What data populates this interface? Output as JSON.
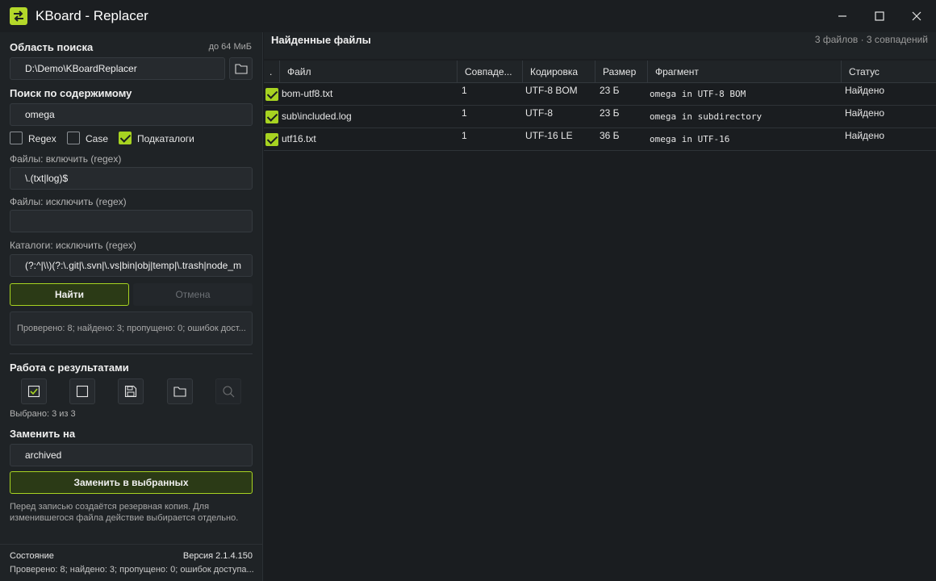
{
  "window": {
    "title": "KBoard - Replacer",
    "controls": [
      "minimize-icon",
      "maximize-icon",
      "close-icon"
    ]
  },
  "left": {
    "search_area": {
      "title": "Область поиска",
      "limit": "до 64 МиБ",
      "path": "D:\\Demo\\KBoardReplacer"
    },
    "content_search": {
      "title": "Поиск по содержимому",
      "query": "omega",
      "options": [
        {
          "label": "Regex",
          "checked": false
        },
        {
          "label": "Case",
          "checked": false
        },
        {
          "label": "Подкаталоги",
          "checked": true
        }
      ]
    },
    "files_include": {
      "label": "Файлы: включить (regex)",
      "value": "\\.(txt|log)$"
    },
    "files_exclude": {
      "label": "Файлы: исключить (regex)",
      "value": ""
    },
    "dirs_exclude": {
      "label": "Каталоги: исключить (regex)",
      "value": "(?:^|\\\\)(?:\\.git|\\.svn|\\.vs|bin|obj|temp|\\.trash|node_m"
    },
    "find_button": "Найти",
    "cancel_button": "Отмена",
    "log": "Проверено: 8; найдено: 3; пропущено: 0; ошибок дост...",
    "results": {
      "title": "Работа с результатами",
      "tools": [
        "check-all-icon",
        "uncheck-all-icon",
        "save-icon",
        "folder-icon",
        "search-icon"
      ],
      "selected": "Выбрано: 3 из 3"
    },
    "replace": {
      "title": "Заменить на",
      "value": "archived",
      "button": "Заменить в выбранных",
      "note": "Перед записью создаётся резервная копия. Для изменившегося файла действие выбирается отдельно."
    },
    "status": {
      "title": "Состояние",
      "version": "Версия 2.1.4.150",
      "text": "Проверено: 8; найдено: 3; пропущено: 0; ошибок доступа..."
    }
  },
  "right": {
    "title": "Найденные файлы",
    "summary": "3 файлов · 3 совпадений",
    "columns": [
      ".",
      "Файл",
      "Совпаде...",
      "Кодировка",
      "Размер",
      "Фрагмент",
      "Статус"
    ],
    "rows": [
      {
        "checked": true,
        "file": "bom-utf8.txt",
        "matches": "1",
        "encoding": "UTF-8 BOM",
        "size": "23 Б",
        "fragment": "omega in UTF-8 BOM",
        "status": "Найдено"
      },
      {
        "checked": true,
        "file": "sub\\included.log",
        "matches": "1",
        "encoding": "UTF-8",
        "size": "23 Б",
        "fragment": "omega in subdirectory",
        "status": "Найдено"
      },
      {
        "checked": true,
        "file": "utf16.txt",
        "matches": "1",
        "encoding": "UTF-16 LE",
        "size": "36 Б",
        "fragment": "omega in UTF-16",
        "status": "Найдено"
      }
    ]
  },
  "colors": {
    "accent": "#a7d321",
    "background": "#1a1d20",
    "panel": "#1f2326"
  }
}
